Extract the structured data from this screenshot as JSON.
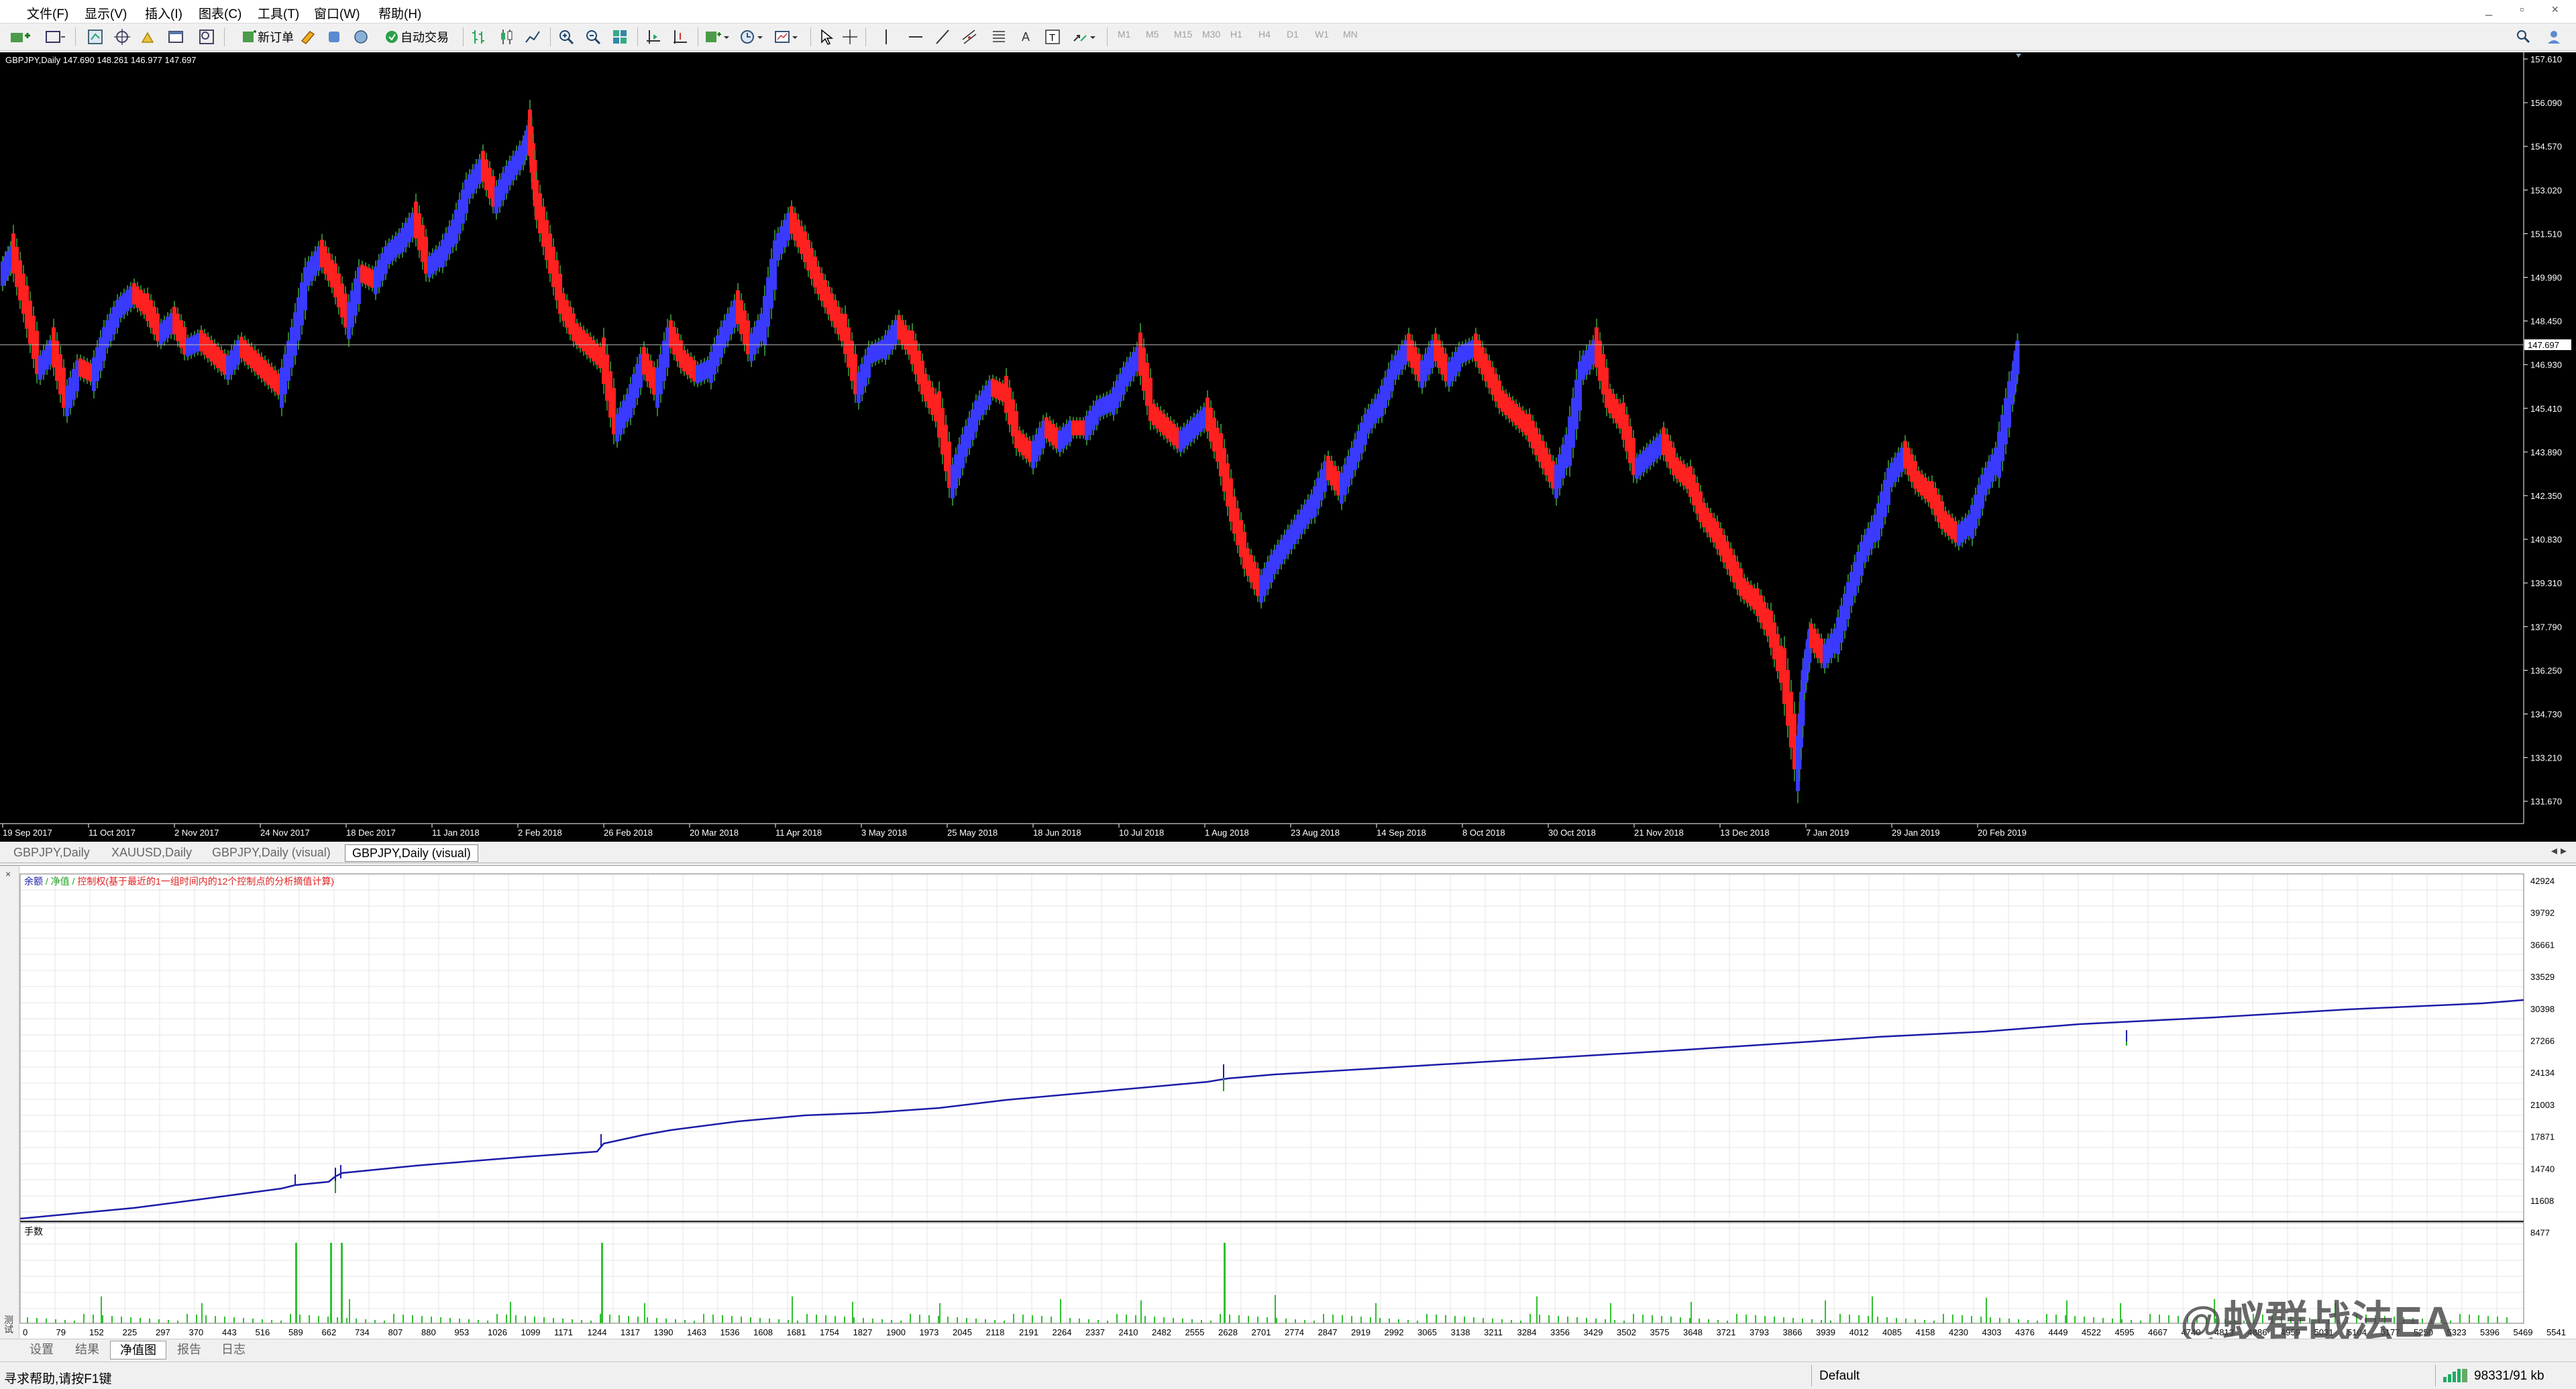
{
  "menu": [
    "文件(F)",
    "显示(V)",
    "插入(I)",
    "图表(C)",
    "工具(T)",
    "窗口(W)",
    "帮助(H)"
  ],
  "toolbar": {
    "new_order": "新订单",
    "auto_trading": "自动交易",
    "timeframes": [
      "M1",
      "M5",
      "M15",
      "M30",
      "H1",
      "H4",
      "D1",
      "W1",
      "MN"
    ]
  },
  "price_chart": {
    "header": "GBPJPY,Daily  147.690 148.261 146.977 147.697",
    "current_price": "147.697",
    "background": "#000000",
    "bull_color": "#3a3aff",
    "bear_color": "#ff2020",
    "y_ticks": [
      "157.610",
      "156.090",
      "154.570",
      "153.020",
      "151.510",
      "149.990",
      "148.450",
      "146.930",
      "145.410",
      "143.890",
      "142.350",
      "140.830",
      "139.310",
      "137.790",
      "136.250",
      "134.730",
      "133.210",
      "131.670"
    ],
    "x_ticks": [
      "19 Sep 2017",
      "11 Oct 2017",
      "2 Nov 2017",
      "24 Nov 2017",
      "18 Dec 2017",
      "11 Jan 2018",
      "2 Feb 2018",
      "26 Feb 2018",
      "20 Mar 2018",
      "11 Apr 2018",
      "3 May 2018",
      "25 May 2018",
      "18 Jun 2018",
      "10 Jul 2018",
      "1 Aug 2018",
      "23 Aug 2018",
      "14 Sep 2018",
      "8 Oct 2018",
      "30 Oct 2018",
      "21 Nov 2018",
      "13 Dec 2018",
      "7 Jan 2019",
      "29 Jan 2019",
      "20 Feb 2019"
    ]
  },
  "chart_tabs": [
    "GBPJPY,Daily",
    "XAUUSD,Daily",
    "GBPJPY,Daily (visual)",
    "GBPJPY,Daily (visual)"
  ],
  "tester": {
    "legend": {
      "balance": "余额",
      "sep1": " / ",
      "equity": "净值",
      "sep2": " / ",
      "drawdown": "控制权(基于最近的1一组时间内的12个控制点的分析摘值计算)"
    },
    "y_ticks": [
      "42924",
      "39792",
      "36661",
      "33529",
      "30398",
      "27266",
      "24134",
      "21003",
      "17871",
      "14740",
      "11608",
      "8477"
    ],
    "lots_label": "手数",
    "x_ticks": [
      "0",
      "79",
      "152",
      "225",
      "297",
      "370",
      "443",
      "516",
      "589",
      "662",
      "734",
      "807",
      "880",
      "953",
      "1026",
      "1099",
      "1171",
      "1244",
      "1317",
      "1390",
      "1463",
      "1536",
      "1608",
      "1681",
      "1754",
      "1827",
      "1900",
      "1973",
      "2045",
      "2118",
      "2191",
      "2264",
      "2337",
      "2410",
      "2482",
      "2555",
      "2628",
      "2701",
      "2774",
      "2847",
      "2919",
      "2992",
      "3065",
      "3138",
      "3211",
      "3284",
      "3356",
      "3429",
      "3502",
      "3575",
      "3648",
      "3721",
      "3793",
      "3866",
      "3939",
      "4012",
      "4085",
      "4158",
      "4230",
      "4303",
      "4376",
      "4449",
      "4522",
      "4595",
      "4667",
      "4740",
      "4813",
      "4886",
      "4959",
      "5031",
      "5104",
      "5177",
      "5250",
      "5323",
      "5396",
      "5469",
      "5541"
    ],
    "balance_color": "#1c1ca8",
    "equity_color": "#20a020",
    "lots_color": "#30c030"
  },
  "bottom_tabs": [
    "设置",
    "结果",
    "净值图",
    "报告",
    "日志"
  ],
  "status": {
    "help": "寻求帮助,请按F1键",
    "profile": "Default",
    "traffic": "98331/91 kb"
  },
  "watermark": "@蚁群战法EA"
}
